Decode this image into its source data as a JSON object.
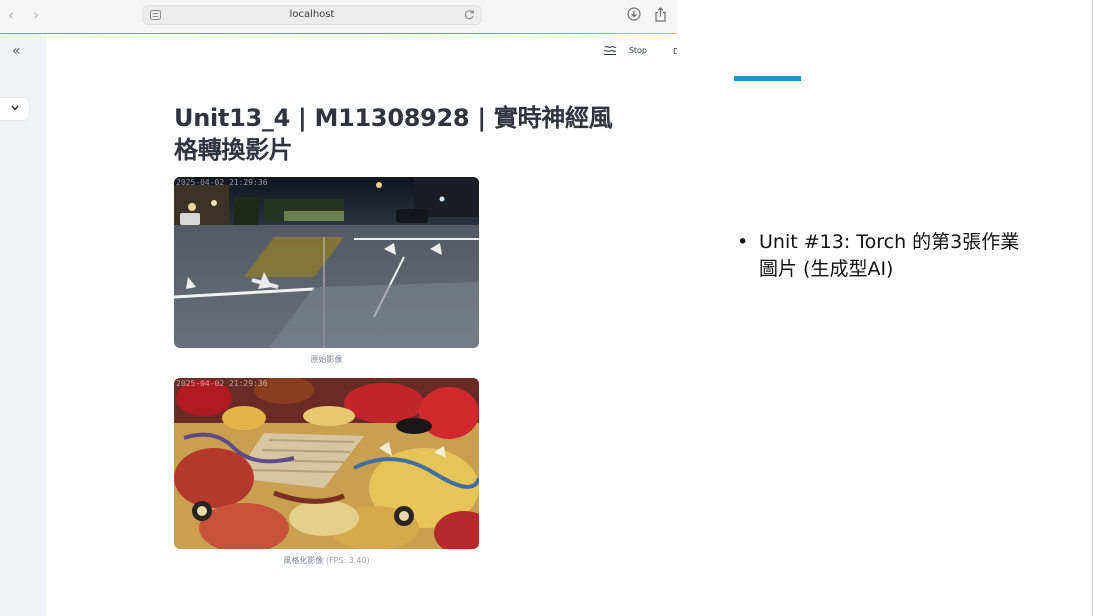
{
  "browser": {
    "address": "localhost",
    "icons": [
      "back-arrow-icon",
      "forward-arrow-icon",
      "page-settings-icon",
      "reload-icon",
      "download-icon",
      "share-icon"
    ]
  },
  "app": {
    "sidebar": {
      "collapse_icon": "double-chevron-left-icon",
      "dropdown_icon": "chevron-down-icon"
    },
    "header": {
      "stop_label": "Stop",
      "deploy_label": "Deploy"
    },
    "title": "Unit13_4 | M11308928 | 實時神經風格轉換影片",
    "original": {
      "caption": "原始影像",
      "timestamp": "2025-04-02 21:29:36"
    },
    "stylized": {
      "caption": "風格化影像",
      "fps_text": "(FPS: 3.40)",
      "timestamp": "2025-04-02 21:29:36"
    }
  },
  "slide": {
    "accent_color": "#1a96c8",
    "bullet": "Unit #13: Torch 的第3張作業圖片 (生成型AI)"
  }
}
